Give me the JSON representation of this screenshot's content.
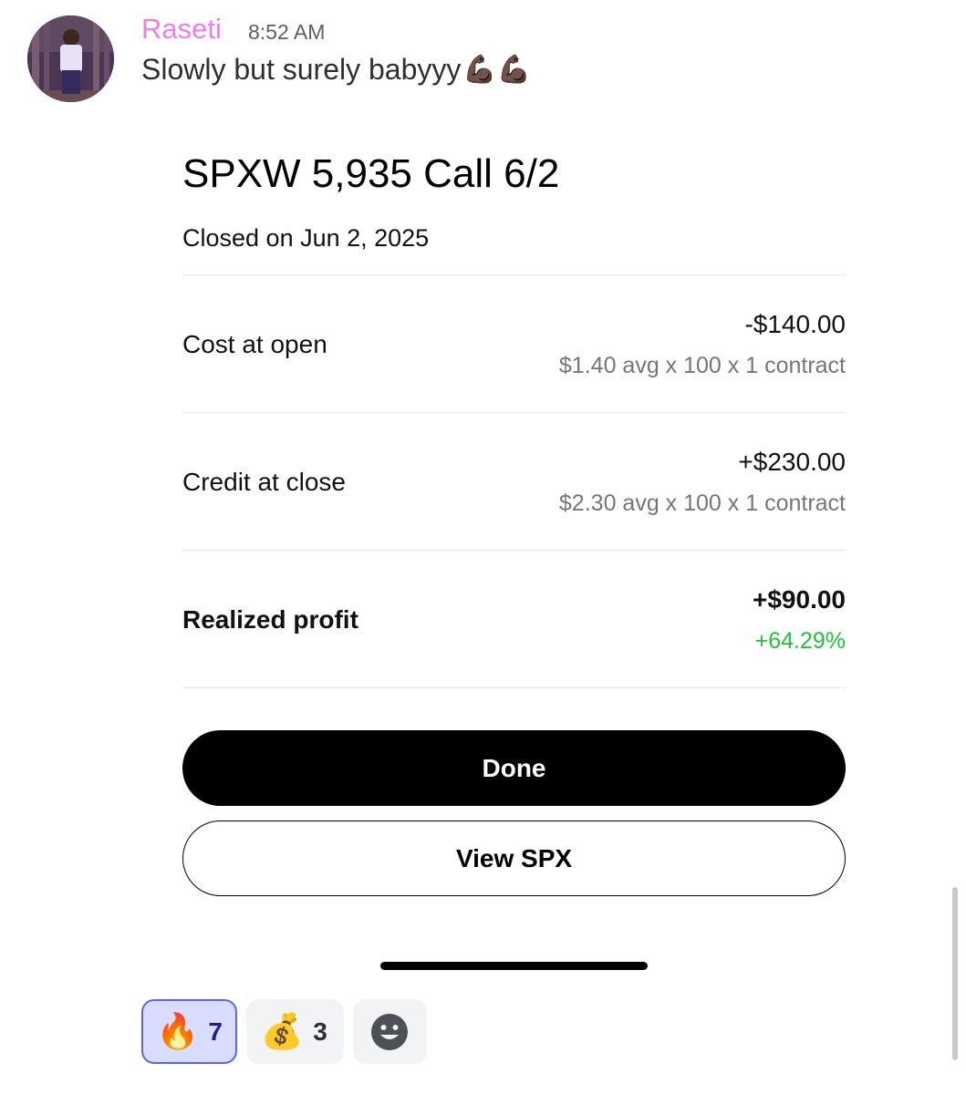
{
  "message": {
    "username": "Raseti",
    "timestamp": "8:52 AM",
    "text": "Slowly but surely babyyy",
    "text_emojis": "💪🏿💪🏿",
    "username_color": "#f27ce6"
  },
  "trade_card": {
    "title": "SPXW 5,935 Call 6/2",
    "closed_on": "Closed on Jun 2, 2025",
    "rows": [
      {
        "label": "Cost at open",
        "value": "-$140.00",
        "sub": "$1.40 avg x 100 x 1 contract"
      },
      {
        "label": "Credit at close",
        "value": "+$230.00",
        "sub": "$2.30 avg x 100 x 1 contract"
      },
      {
        "label": "Realized profit",
        "value": "+$90.00",
        "sub": "+64.29%",
        "sub_color": "#1ec33a"
      }
    ],
    "done_button": "Done",
    "view_button": "View SPX"
  },
  "reactions": [
    {
      "emoji": "🔥",
      "icon": "fire-icon",
      "count": "7",
      "active": true
    },
    {
      "emoji": "💰",
      "icon": "money-bag-icon",
      "count": "3",
      "active": false
    }
  ],
  "add_reaction_icon": "smiley-icon"
}
